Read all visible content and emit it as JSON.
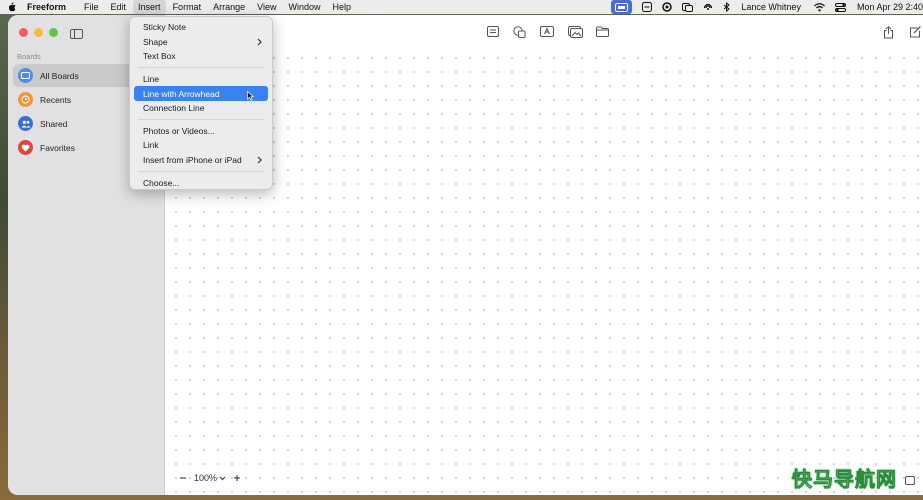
{
  "menubar": {
    "app_name": "Freeform",
    "menus": [
      "File",
      "Edit",
      "Insert",
      "Format",
      "Arrange",
      "View",
      "Window",
      "Help"
    ],
    "active_menu": "Insert",
    "user_name": "Lance Whitney",
    "clock": "Mon Apr 29  2:40"
  },
  "sidebar": {
    "section_label": "Boards",
    "items": [
      {
        "label": "All Boards",
        "icon": "grid-icon",
        "color": "#4a8ef0"
      },
      {
        "label": "Recents",
        "icon": "clock-icon",
        "color": "#f0953a"
      },
      {
        "label": "Shared",
        "icon": "people-icon",
        "color": "#3b6fd6"
      },
      {
        "label": "Favorites",
        "icon": "heart-icon",
        "color": "#e0443a"
      }
    ]
  },
  "insert_menu": {
    "groups": [
      [
        {
          "label": "Sticky Note",
          "submenu": false
        },
        {
          "label": "Shape",
          "submenu": true
        },
        {
          "label": "Text Box",
          "submenu": false
        }
      ],
      [
        {
          "label": "Line",
          "submenu": false
        },
        {
          "label": "Line with Arrowhead",
          "submenu": false,
          "highlighted": true
        },
        {
          "label": "Connection Line",
          "submenu": false
        }
      ],
      [
        {
          "label": "Photos or Videos...",
          "submenu": false
        },
        {
          "label": "Link",
          "submenu": false
        },
        {
          "label": "Insert from iPhone or iPad",
          "submenu": true
        }
      ],
      [
        {
          "label": "Choose...",
          "submenu": false
        }
      ]
    ]
  },
  "zoom": {
    "level": "100%"
  },
  "watermark": "快马导航网",
  "colors": {
    "highlight": "#3b82f0",
    "status_highlight": "#4a6cd6"
  }
}
